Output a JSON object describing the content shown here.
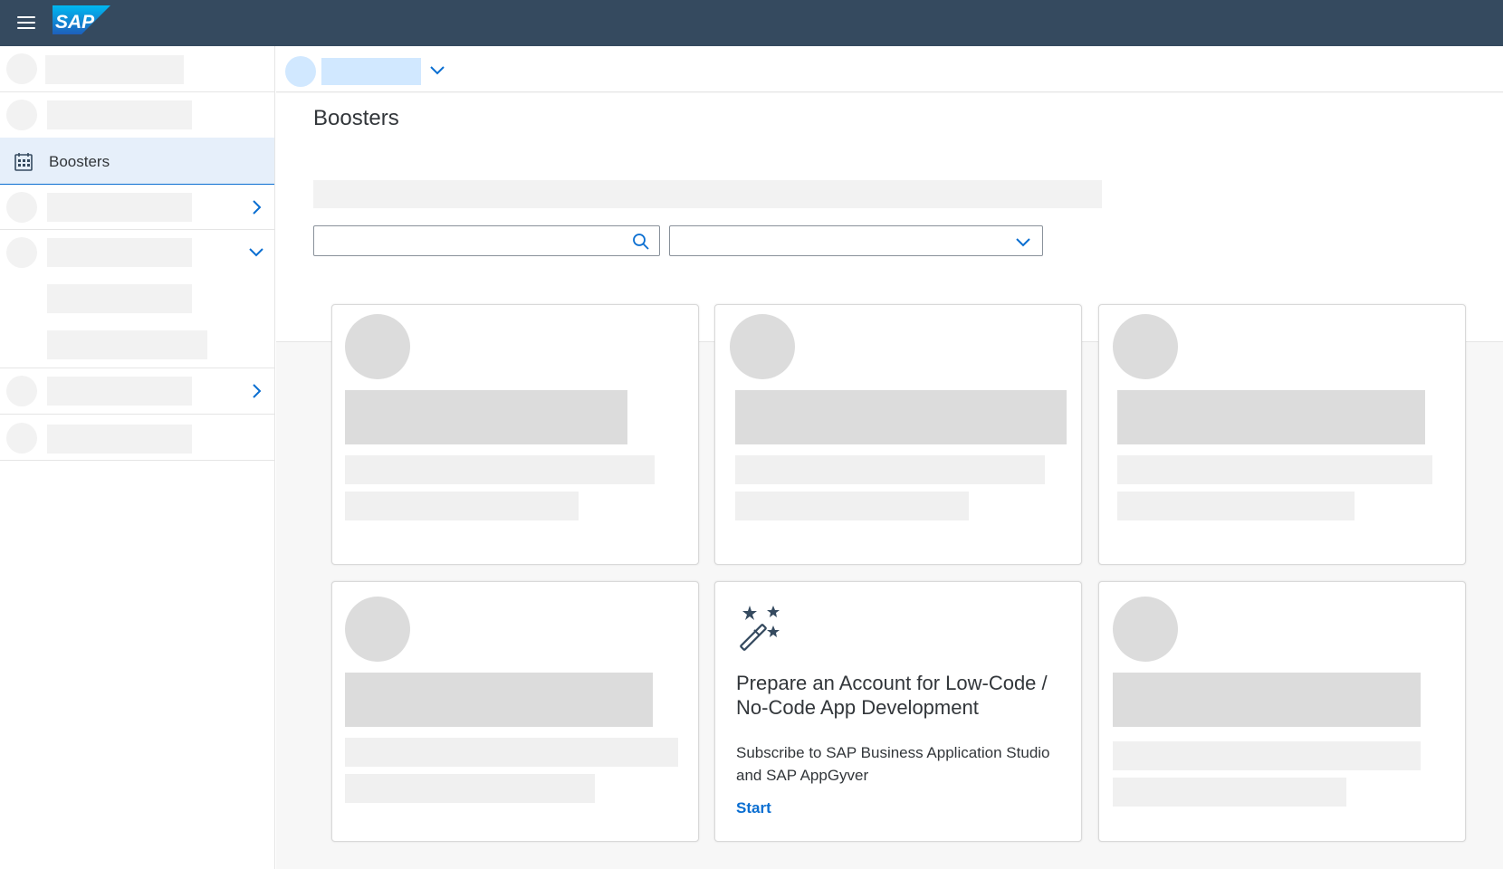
{
  "shellbar": {
    "logo_text": "SAP",
    "menu_icon": "hamburger-menu-icon",
    "background_color": "#354a5f"
  },
  "sidebar": {
    "selected_item": {
      "label": "Boosters",
      "icon": "calendar-grid-icon"
    },
    "selected_color": "#e6effa"
  },
  "subheader": {
    "dropdown_icon": "chevron-down-icon"
  },
  "page": {
    "title": "Boosters",
    "search": {
      "value": "",
      "placeholder": "",
      "icon": "search-icon"
    },
    "filter": {
      "selected": "",
      "icon": "chevron-down-icon"
    }
  },
  "cards": {
    "featured": {
      "icon": "magic-wand-icon",
      "title": "Prepare an Account for Low-Code / No-Code App Development",
      "description": "Subscribe to SAP Business Application Studio and SAP AppGyver",
      "link": "Start"
    }
  },
  "colors": {
    "accent": "#0a6ed1",
    "text": "#32363a",
    "placeholder_light": "#f2f2f2",
    "placeholder_dark": "#dcdcdc",
    "icon_blue": "#354a5f"
  }
}
